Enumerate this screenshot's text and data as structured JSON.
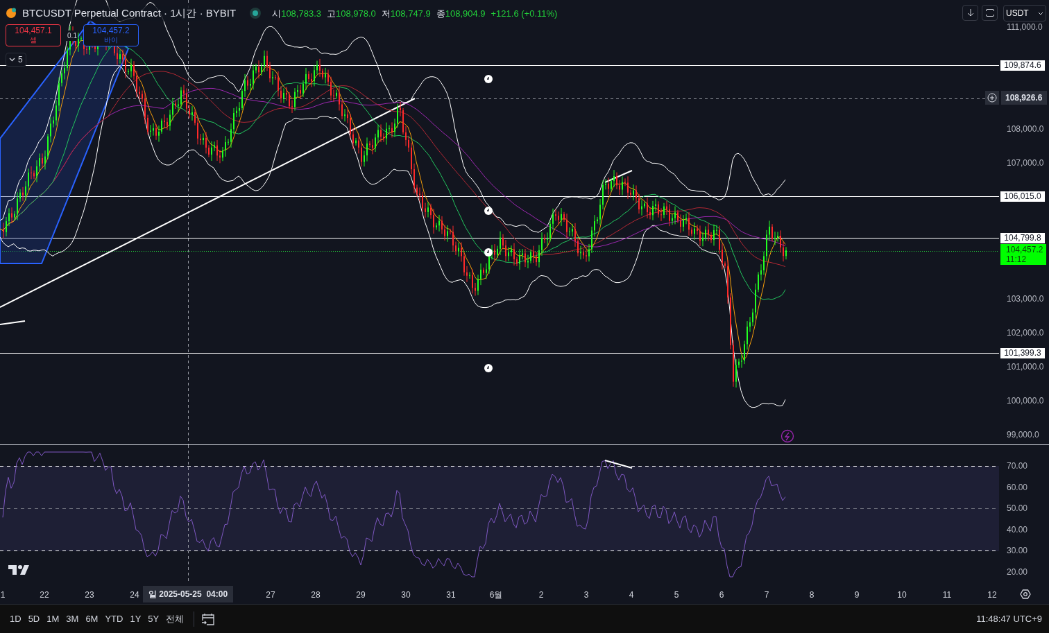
{
  "header": {
    "symbol": "BTCUSDT Perpetual Contract · 1시간 · BYBIT",
    "ohlc": [
      {
        "label": "시",
        "value": "108,783.3"
      },
      {
        "label": "고",
        "value": "108,978.0"
      },
      {
        "label": "저",
        "value": "108,747.9"
      },
      {
        "label": "종",
        "value": "108,904.9"
      }
    ],
    "change": "+121.6 (+0.11%)"
  },
  "trade": {
    "sell": {
      "price": "104,457.1",
      "label": "셀"
    },
    "spread": "0.1",
    "buy": {
      "price": "104,457.2",
      "label": "바이"
    }
  },
  "indicators_toggle": {
    "count": "5"
  },
  "toolbar": {
    "currency": "USDT"
  },
  "price_axis": {
    "labels": [
      {
        "kind": "tick",
        "text": "111,000.0"
      },
      {
        "kind": "line",
        "text": "109,874.6"
      },
      {
        "kind": "crosshair",
        "text": "108,926.6"
      },
      {
        "kind": "tick",
        "text": "108,000.0"
      },
      {
        "kind": "tick",
        "text": "107,000.0"
      },
      {
        "kind": "line",
        "text": "106,015.0"
      },
      {
        "kind": "line",
        "text": "104,799.8"
      },
      {
        "kind": "last",
        "text": "104,457.2",
        "countdown": "11:12"
      },
      {
        "kind": "tick",
        "text": "103,000.0"
      },
      {
        "kind": "tick",
        "text": "102,000.0"
      },
      {
        "kind": "line",
        "text": "101,399.3"
      },
      {
        "kind": "tick",
        "text": "101,000.0"
      },
      {
        "kind": "tick",
        "text": "100,000.0"
      },
      {
        "kind": "tick",
        "text": "99,000.0"
      }
    ]
  },
  "rsi_axis": {
    "labels": [
      "70.00",
      "60.00",
      "50.00",
      "40.00",
      "30.00",
      "20.00"
    ]
  },
  "time_axis": {
    "labels": [
      "1",
      "22",
      "23",
      "24",
      "27",
      "28",
      "29",
      "30",
      "31",
      "6월",
      "2",
      "3",
      "4",
      "5",
      "6",
      "7",
      "8",
      "9",
      "10",
      "11",
      "12"
    ],
    "crosshair": "일 2025-05-25  04:00"
  },
  "range_buttons": [
    "1D",
    "5D",
    "1M",
    "3M",
    "6M",
    "YTD",
    "1Y",
    "5Y",
    "전체"
  ],
  "clock": "11:48:47 UTC+9"
}
